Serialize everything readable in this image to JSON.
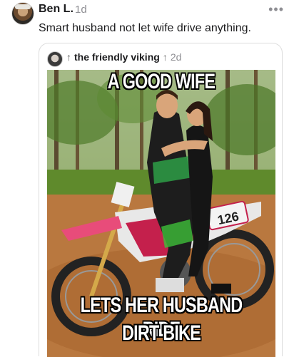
{
  "post": {
    "author": "Ben L.",
    "time": "1d",
    "more_icon": "more-horizontal-icon",
    "text": "Smart husband not let wife drive anything."
  },
  "quoted": {
    "repost_arrow": "↑",
    "author": "the friendly viking",
    "trending_arrow": "↑",
    "time": "2d",
    "meme": {
      "top_text": "A GOOD WIFE",
      "bottom_line1": "LETS HER HUSBAND RIDE",
      "bottom_line2": "DIRT BIKE",
      "bike_number": "126"
    }
  }
}
